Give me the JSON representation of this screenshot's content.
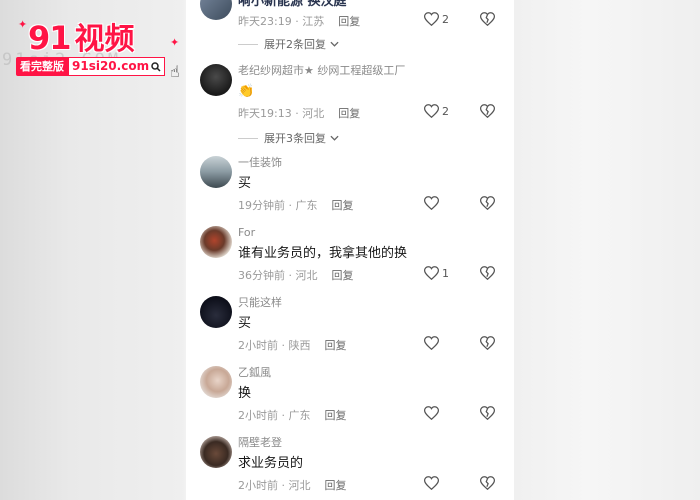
{
  "watermark": {
    "ghost": "91si2.COM",
    "brand_num": "91",
    "brand_cn": "视频",
    "tag": "看完整版",
    "url": "91si20.com"
  },
  "top_comment": {
    "text_partial": "嗬小新能源 换汉庭",
    "time": "昨天23:19",
    "region": "江苏",
    "reply": "回复",
    "likes": "2",
    "expand": "展开2条回复"
  },
  "comments": [
    {
      "nick": "老纪纱网超市★ 纱网工程超级工厂",
      "text": "👏",
      "time": "昨天19:13",
      "region": "河北",
      "reply": "回复",
      "likes": "2",
      "expand": "展开3条回复"
    },
    {
      "nick": "一佳装饰",
      "text": "买",
      "time": "19分钟前",
      "region": "广东",
      "reply": "回复",
      "likes": ""
    },
    {
      "nick": "For",
      "text": "谁有业务员的，我拿其他的换",
      "time": "36分钟前",
      "region": "河北",
      "reply": "回复",
      "likes": "1"
    },
    {
      "nick": "只能这样",
      "text": "买",
      "time": "2小时前",
      "region": "陕西",
      "reply": "回复",
      "likes": ""
    },
    {
      "nick": "乙鈲風",
      "text": "换",
      "time": "2小时前",
      "region": "广东",
      "reply": "回复",
      "likes": ""
    },
    {
      "nick": "隔壁老登",
      "text": "求业务员的",
      "time": "2小时前",
      "region": "河北",
      "reply": "回复",
      "likes": ""
    }
  ]
}
